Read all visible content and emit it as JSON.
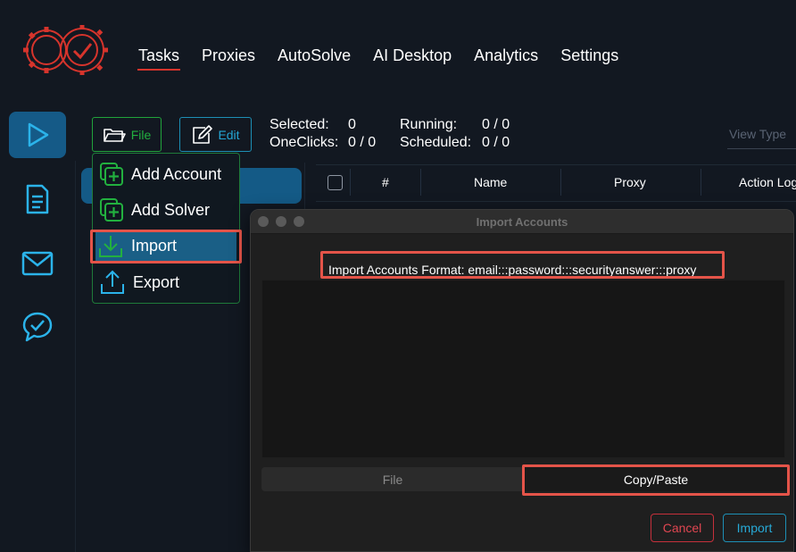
{
  "nav": {
    "items": [
      {
        "label": "Tasks",
        "active": true
      },
      {
        "label": "Proxies"
      },
      {
        "label": "AutoSolve"
      },
      {
        "label": "AI Desktop"
      },
      {
        "label": "Analytics"
      },
      {
        "label": "Settings"
      }
    ]
  },
  "sidebar": {
    "items": [
      {
        "icon": "play-icon",
        "active": true
      },
      {
        "icon": "document-icon"
      },
      {
        "icon": "mail-icon"
      },
      {
        "icon": "chat-check-icon"
      }
    ]
  },
  "toolbar": {
    "file_label": "File",
    "edit_label": "Edit",
    "selected_label": "Selected:",
    "selected_value": "0",
    "oneclicks_label": "OneClicks:",
    "oneclicks_value": "0 / 0",
    "running_label": "Running:",
    "running_value": "0 / 0",
    "scheduled_label": "Scheduled:",
    "scheduled_value": "0 / 0",
    "view_type_placeholder": "View Type"
  },
  "file_menu": {
    "items": [
      {
        "label": "Add Account",
        "icon": "add-account-icon"
      },
      {
        "label": "Add Solver",
        "icon": "add-solver-icon"
      },
      {
        "label": "Import",
        "icon": "import-icon",
        "selected": true
      },
      {
        "label": "Export",
        "icon": "export-icon"
      }
    ]
  },
  "table": {
    "columns": [
      "#",
      "Name",
      "Proxy",
      "Action Log"
    ]
  },
  "dialog": {
    "title": "Import Accounts",
    "format_text": "Import Accounts Format: email:::password:::securityanswer:::proxy",
    "tab_file": "File",
    "tab_copy": "Copy/Paste",
    "cancel_label": "Cancel",
    "import_label": "Import"
  },
  "colors": {
    "background": "#121821",
    "accent_blue": "#155a87",
    "accent_green": "#21a33b",
    "accent_red": "#d6342c",
    "highlight": "#e45449"
  }
}
